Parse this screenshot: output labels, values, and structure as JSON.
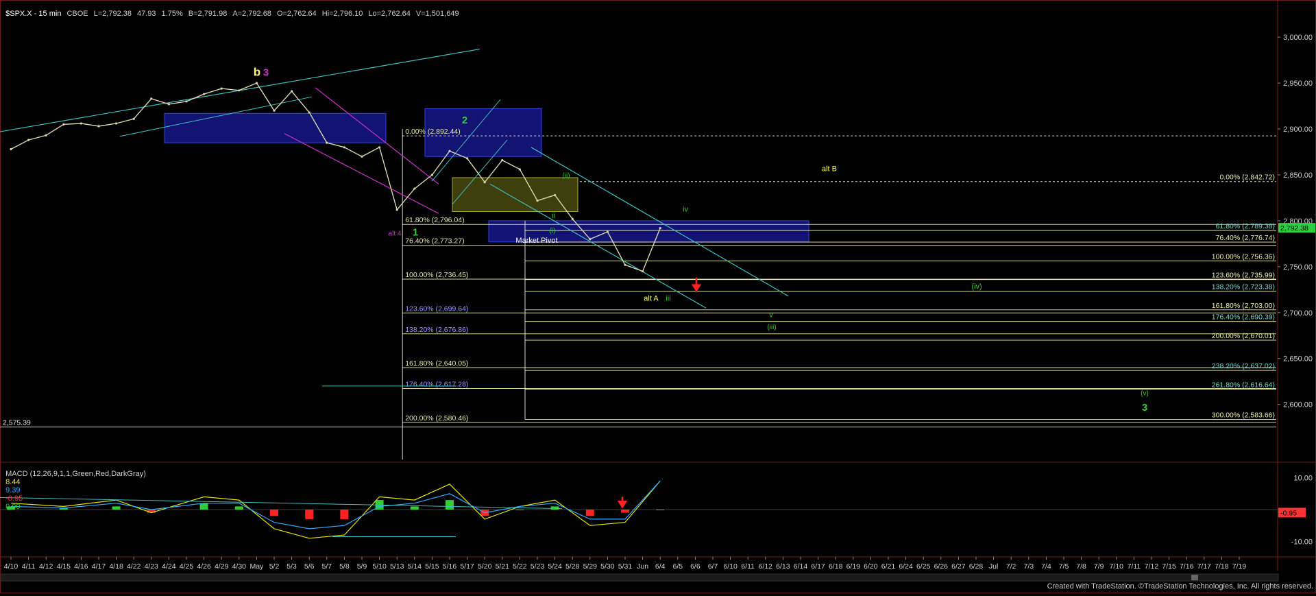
{
  "header": {
    "symbol": "$SPX.X - 15 min",
    "exchange": "CBOE",
    "last": "L=2,792.38",
    "change": "47.93",
    "change_pct": "1.75%",
    "bid": "B=2,791.98",
    "ask": "A=2,792.68",
    "open": "O=2,762.64",
    "high": "Hi=2,796.10",
    "low": "Lo=2,762.64",
    "volume": "V=1,501,649"
  },
  "macd": {
    "label": "MACD (12,26,9,1,1,Green,Red,DarkGray)",
    "v1": "8.44",
    "v2": "9.39",
    "v3": "-0.95",
    "v4": "0.00"
  },
  "footer": "Created with TradeStation. ©TradeStation Technologies, Inc. All rights reserved.",
  "colors": {
    "background": "#000000",
    "price": "#d8d8b0",
    "yellow": "#ffff66",
    "green": "#33cc33",
    "magenta": "#cc33cc",
    "cyan": "#3fbfbf",
    "blue_box": "#1a1a9a",
    "fib_left": "#ffffaa",
    "fib_right": "#ffffaa",
    "red": "#ff2222",
    "last_price_tag": "#2ecc40"
  },
  "chart_data": [
    {
      "type": "line",
      "title": "$SPX.X - 15 min",
      "y_ticks": [
        "3,000.00",
        "2,950.00",
        "2,900.00",
        "2,850.00",
        "2,800.00",
        "2,750.00",
        "2,700.00",
        "2,650.00",
        "2,600.00"
      ],
      "ylim": [
        2540,
        3030
      ],
      "x_ticks": [
        "4/10",
        "4/11",
        "4/12",
        "4/15",
        "4/16",
        "4/17",
        "4/18",
        "4/22",
        "4/23",
        "4/24",
        "4/25",
        "4/26",
        "4/29",
        "4/30",
        "May",
        "5/2",
        "5/3",
        "5/6",
        "5/7",
        "5/8",
        "5/9",
        "5/10",
        "5/13",
        "5/14",
        "5/15",
        "5/16",
        "5/17",
        "5/20",
        "5/21",
        "5/22",
        "5/23",
        "5/24",
        "5/28",
        "5/29",
        "5/30",
        "5/31",
        "Jun",
        "6/4",
        "6/5",
        "6/6",
        "6/7",
        "6/10",
        "6/11",
        "6/12",
        "6/13",
        "6/14",
        "6/17",
        "6/18",
        "6/19",
        "6/20",
        "6/21",
        "6/24",
        "6/25",
        "6/26",
        "6/27",
        "6/28",
        "Jul",
        "7/2",
        "7/3",
        "7/4",
        "7/5",
        "7/8",
        "7/9",
        "7/10",
        "7/11",
        "7/12",
        "7/15",
        "7/16",
        "7/17",
        "7/18",
        "7/19"
      ],
      "x": [
        "4/10",
        "4/11",
        "4/12",
        "4/15",
        "4/16",
        "4/17",
        "4/18",
        "4/22",
        "4/23",
        "4/24",
        "4/25",
        "4/26",
        "4/29",
        "4/30",
        "May",
        "5/2",
        "5/3",
        "5/6",
        "5/7",
        "5/8",
        "5/9",
        "5/10",
        "5/13",
        "5/14",
        "5/15",
        "5/16",
        "5/17",
        "5/20",
        "5/21",
        "5/22",
        "5/23",
        "5/24",
        "5/28",
        "5/29",
        "5/30",
        "5/31",
        "Jun",
        "6/4"
      ],
      "series": [
        {
          "values": [
            2878,
            2888,
            2893,
            2905,
            2906,
            2903,
            2906,
            2911,
            2933,
            2927,
            2930,
            2938,
            2944,
            2942,
            2950,
            2920,
            2941,
            2918,
            2885,
            2880,
            2870,
            2880,
            2812,
            2835,
            2850,
            2876,
            2868,
            2842,
            2866,
            2856,
            2822,
            2828,
            2802,
            2780,
            2788,
            2752,
            2745,
            2792
          ]
        }
      ],
      "last_price_tag": "2,792.38",
      "left_level_tag": "2,575.39",
      "fib_left": [
        {
          "label": "0.00% (2,892.44)",
          "value": 2892.44
        },
        {
          "label": "61.80% (2,796.04)",
          "value": 2796.04
        },
        {
          "label": "76.40% (2,773.27)",
          "value": 2773.27
        },
        {
          "label": "100.00% (2,736.45)",
          "value": 2736.45
        },
        {
          "label": "123.60% (2,699.64)",
          "value": 2699.64
        },
        {
          "label": "138.20% (2,676.86)",
          "value": 2676.86
        },
        {
          "label": "161.80% (2,640.05)",
          "value": 2640.05
        },
        {
          "label": "176.40% (2,617.28)",
          "value": 2617.28
        },
        {
          "label": "200.00% (2,580.46)",
          "value": 2580.46
        }
      ],
      "fib_right": [
        {
          "label": "0.00% (2,842.72)",
          "value": 2842.72
        },
        {
          "label": "61.80% (2,789.38)",
          "value": 2789.38
        },
        {
          "label": "76.40% (2,776.74)",
          "value": 2776.74
        },
        {
          "label": "100.00% (2,756.36)",
          "value": 2756.36
        },
        {
          "label": "123.60% (2,735.99)",
          "value": 2735.99
        },
        {
          "label": "138.20% (2,723.38)",
          "value": 2723.38
        },
        {
          "label": "161.80% (2,703.00)",
          "value": 2703.0
        },
        {
          "label": "176.40% (2,690.39)",
          "value": 2690.39
        },
        {
          "label": "200.00% (2,670.01)",
          "value": 2670.01
        },
        {
          "label": "238.20% (2,637.02)",
          "value": 2637.02
        },
        {
          "label": "261.80% (2,616.64)",
          "value": 2616.64
        },
        {
          "label": "300.00% (2,583.66)",
          "value": 2583.66
        }
      ],
      "annotations": [
        {
          "text": "b",
          "color": "yellow"
        },
        {
          "text": "3",
          "color": "magenta"
        },
        {
          "text": "2",
          "color": "green"
        },
        {
          "text": "1",
          "color": "green"
        },
        {
          "text": "alt 4",
          "color": "magenta"
        },
        {
          "text": "alt B",
          "color": "yellow"
        },
        {
          "text": "(i)",
          "color": "green"
        },
        {
          "text": "(ii)",
          "color": "green"
        },
        {
          "text": "iv",
          "color": "green"
        },
        {
          "text": "iii",
          "color": "green"
        },
        {
          "text": "ii",
          "color": "green"
        },
        {
          "text": "alt A",
          "color": "yellow"
        },
        {
          "text": "(iv)",
          "color": "green"
        },
        {
          "text": "v",
          "color": "green"
        },
        {
          "text": "(iii)",
          "color": "green"
        },
        {
          "text": "(v)",
          "color": "green"
        },
        {
          "text": "3",
          "color": "green"
        },
        {
          "text": "Market Pivot",
          "color": "white"
        }
      ]
    },
    {
      "type": "line",
      "title": "MACD (12,26,9,1,1,Green,Red,DarkGray)",
      "y_ticks": [
        "10.00",
        "-10.00"
      ],
      "ylim": [
        -14,
        14
      ],
      "last_value_tag": "-0.95",
      "x": [
        "4/10",
        "4/15",
        "4/18",
        "4/23",
        "4/26",
        "4/30",
        "5/2",
        "5/6",
        "5/8",
        "5/10",
        "5/14",
        "5/16",
        "5/20",
        "5/22",
        "5/24",
        "5/29",
        "5/31",
        "6/4"
      ],
      "series": [
        {
          "values": [
            2,
            1,
            3,
            -1,
            4,
            3,
            -6,
            -9,
            -8,
            4,
            3,
            8,
            -3,
            1,
            3,
            -5,
            -4,
            9
          ]
        },
        {
          "values": [
            1,
            0.5,
            2,
            0,
            2,
            2,
            -4,
            -6,
            -5,
            1,
            2,
            5,
            -1,
            1,
            2,
            -3,
            -3,
            9
          ]
        }
      ]
    }
  ]
}
